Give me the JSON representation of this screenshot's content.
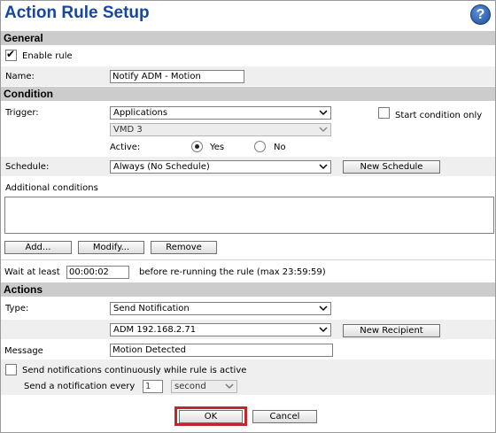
{
  "title": "Action Rule Setup",
  "help_icon": "?",
  "colors": {
    "title": "#17469e",
    "section_bg": "#cccccc",
    "highlight": "#c0262c"
  },
  "general": {
    "header": "General",
    "enable_rule_label": "Enable rule",
    "enable_rule_checked": true,
    "name_label": "Name:",
    "name_value": "Notify ADM - Motion"
  },
  "condition": {
    "header": "Condition",
    "trigger_label": "Trigger:",
    "trigger_value": "Applications",
    "trigger_sub_value": "VMD 3",
    "start_condition_label": "Start condition only",
    "start_condition_checked": false,
    "active_label": "Active:",
    "active_yes": "Yes",
    "active_no": "No",
    "active_selected": "Yes",
    "schedule_label": "Schedule:",
    "schedule_value": "Always (No Schedule)",
    "new_schedule_button": "New Schedule",
    "additional_conditions_label": "Additional conditions",
    "add_button": "Add...",
    "modify_button": "Modify...",
    "remove_button": "Remove",
    "wait_label": "Wait at least",
    "wait_value": "00:00:02",
    "wait_suffix": "before re-running the rule (max 23:59:59)"
  },
  "actions": {
    "header": "Actions",
    "type_label": "Type:",
    "type_value": "Send Notification",
    "recipient_value": "ADM 192.168.2.71",
    "new_recipient_button": "New Recipient",
    "message_label": "Message",
    "message_value": "Motion Detected",
    "continuous_label": "Send notifications continuously while rule is active",
    "continuous_checked": false,
    "every_label": "Send a notification every",
    "every_value": "1",
    "every_unit": "second"
  },
  "footer": {
    "ok_button": "OK",
    "cancel_button": "Cancel"
  }
}
